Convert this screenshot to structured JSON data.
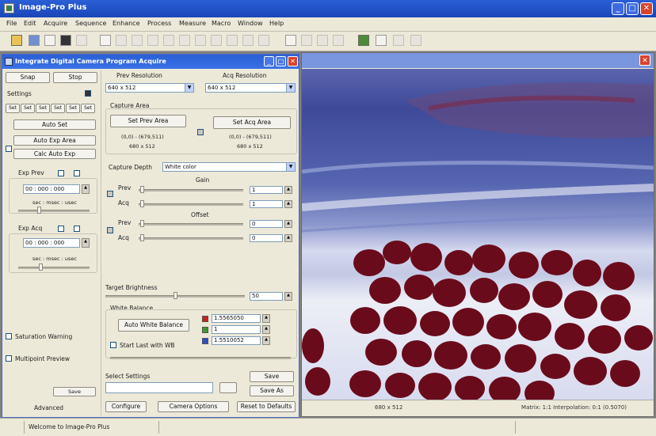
{
  "app": {
    "title": "Image-Pro Plus"
  },
  "menu": [
    "File",
    "Edit",
    "Acquire",
    "Sequence",
    "Enhance",
    "Process",
    "Measure",
    "Macro",
    "Window",
    "Help"
  ],
  "panel": {
    "title": "Integrate Digital Camera Program Acquire",
    "snap": "Snap",
    "stop": "Stop",
    "settings": "Settings",
    "presets": [
      "Set",
      "Set",
      "Set",
      "Set",
      "Set",
      "Set"
    ],
    "auto_set": "Auto Set",
    "auto_exp_area": "Auto Exp Area",
    "calc_auto_exp": "Calc Auto Exp",
    "exp_prev": "Exp Prev",
    "exp_prev_time": "00 : 000 : 000",
    "exp_prev_unit": "sec : msec : usec",
    "exp_acq": "Exp Acq",
    "exp_acq_time": "00 : 000 : 000",
    "exp_acq_unit": "sec : msec : usec",
    "saturation_warning": "Saturation Warning",
    "multipoint_preview": "Multipoint Preview",
    "save": "Save",
    "advanced": "Advanced",
    "prev_resolution": "Prev Resolution",
    "prev_resolution_value": "640 x 512",
    "acq_resolution": "Acq Resolution",
    "acq_resolution_value": "640 x 512",
    "capture_area": "Capture Area",
    "set_prev_area": "Set Prev Area",
    "set_acq_area": "Set Acq Area",
    "prev_area_coords": "(0,0) - (679,511)",
    "prev_area_size": "680 x 512",
    "acq_area_coords": "(0,0) - (679,511)",
    "acq_area_size": "680 x 512",
    "capture_depth": "Capture Depth",
    "capture_depth_value": "White color",
    "gain": "Gain",
    "gain_prev": "Prev",
    "gain_acq": "Acq",
    "gain_prev_value": "1",
    "gain_acq_value": "1",
    "offset": "Offset",
    "offset_prev": "Prev",
    "offset_acq": "Acq",
    "offset_prev_value": "0",
    "offset_acq_value": "0",
    "target_brightness": "Target Brightness",
    "target_brightness_value": "50",
    "white_balance": "White Balance",
    "auto_white_balance": "Auto White Balance",
    "wb_red": "1.5565050",
    "wb_green": "1",
    "wb_blue": "1.5510052",
    "start_last_with_wb": "Start Last with WB",
    "select_settings": "Select Settings",
    "save_btn": "Save",
    "save_as": "Save As",
    "configure": "Configure",
    "camera_options": "Camera Options",
    "reset_to_defaults": "Reset to Defaults"
  },
  "image_window": {
    "status_resolution": "680 x 512",
    "status_info": "Matrix: 1:1 Interpolation: 0:1 (0.5070)"
  },
  "status_bar": {
    "message": "Welcome to Image-Pro Plus"
  },
  "colors": {
    "titlebar": "#1a46b8",
    "face": "#ece9d8",
    "stain_blue": "#4c5ca6",
    "stain_red": "#6c0a18"
  }
}
